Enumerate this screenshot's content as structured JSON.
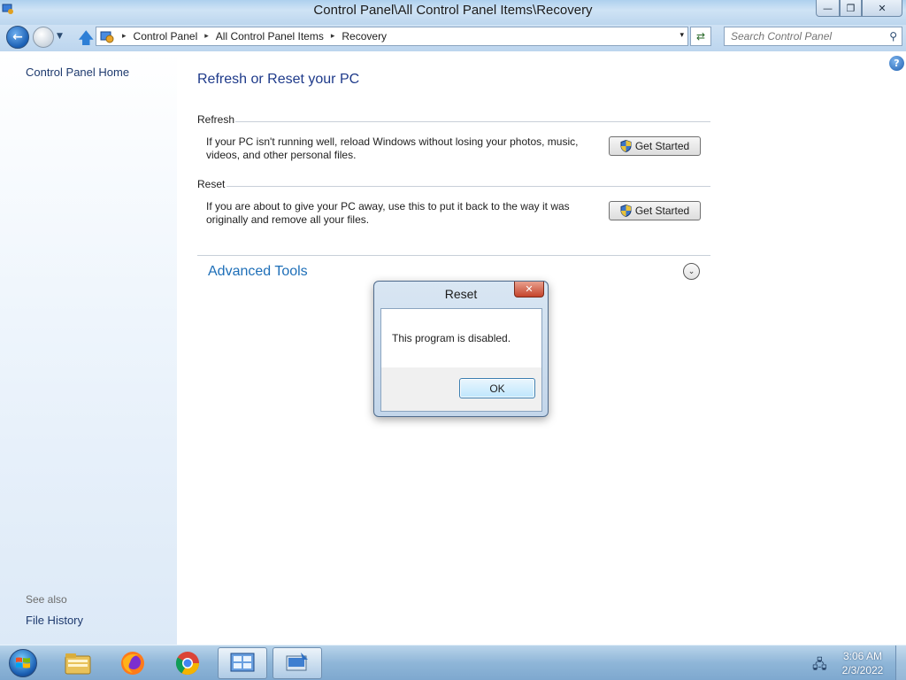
{
  "window": {
    "title": "Control Panel\\All Control Panel Items\\Recovery",
    "minimize_glyph": "—",
    "maximize_glyph": "❐",
    "close_glyph": "✕"
  },
  "address_bar": {
    "breadcrumbs": [
      "Control Panel",
      "All Control Panel Items",
      "Recovery"
    ],
    "separator": "▸",
    "dropdown_glyph": "▾",
    "search_placeholder": "Search Control Panel"
  },
  "left_pane": {
    "home_link": "Control Panel Home",
    "see_also_label": "See also",
    "see_also_links": [
      "File History"
    ]
  },
  "main": {
    "heading": "Refresh or Reset your PC",
    "help_glyph": "?",
    "sections": [
      {
        "label": "Refresh",
        "description": "If your PC isn't running well, reload Windows without losing your photos, music, videos, and other personal files.",
        "button": "Get Started"
      },
      {
        "label": "Reset",
        "description": "If you are about to give your PC away, use this to put it back to the way it was originally and remove all your files.",
        "button": "Get Started"
      }
    ],
    "advanced_tools": "Advanced Tools",
    "chevron_glyph": "⌄"
  },
  "dialog": {
    "title": "Reset",
    "message": "This program is disabled.",
    "ok_label": "OK",
    "close_glyph": "✕"
  },
  "taskbar": {
    "pinned": [
      "windows-explorer",
      "firefox",
      "chrome",
      "control-panel",
      "recovery-window"
    ],
    "clock_time": "3:06 AM",
    "clock_date": "2/3/2022"
  },
  "colors": {
    "link_blue": "#1e3a8a",
    "advanced_blue": "#1e6fb8",
    "close_red": "#c5442c",
    "taskbar": "#8fb6d8"
  }
}
